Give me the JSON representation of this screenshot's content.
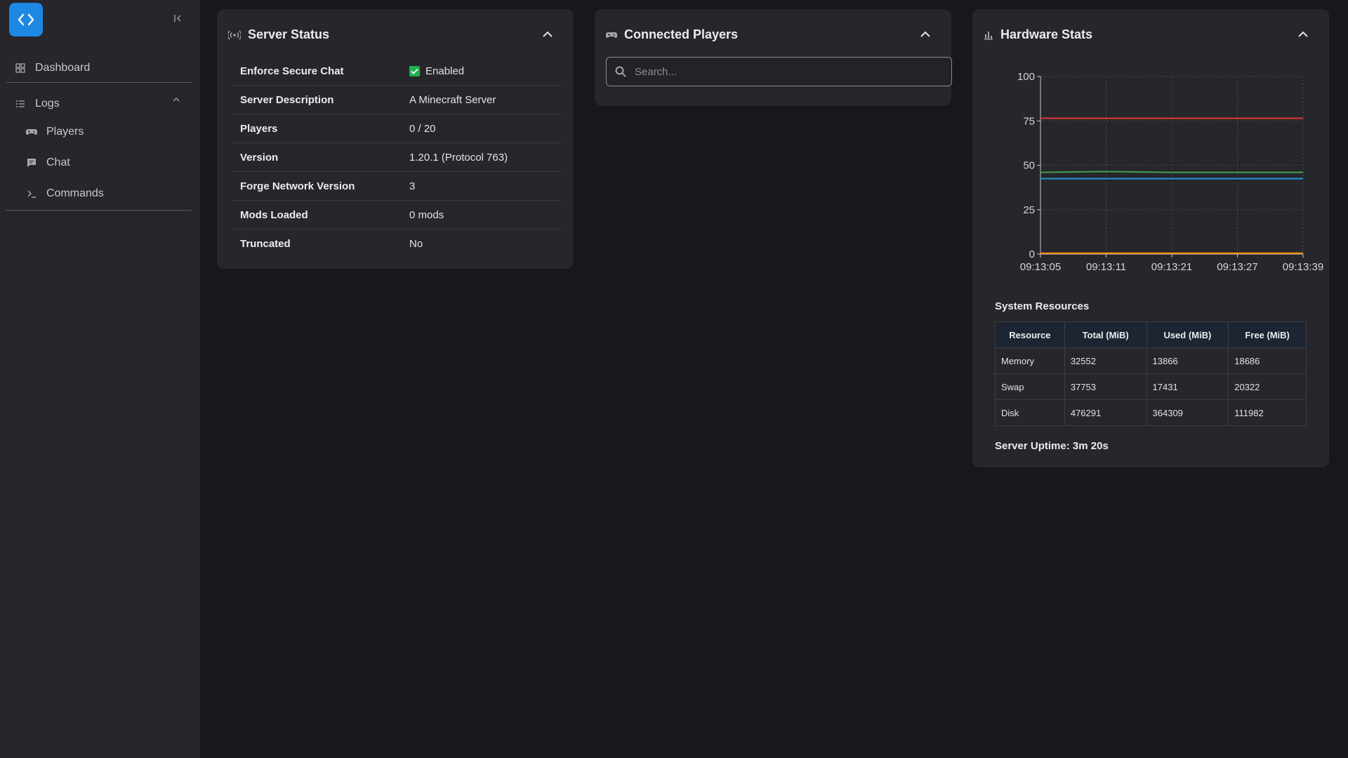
{
  "sidebar": {
    "items": [
      {
        "label": "Dashboard",
        "icon": "grid-icon"
      },
      {
        "label": "Logs",
        "icon": "list-icon"
      },
      {
        "label": "Players",
        "icon": "gamepad-icon"
      },
      {
        "label": "Chat",
        "icon": "chat-icon"
      },
      {
        "label": "Commands",
        "icon": "terminal-icon"
      }
    ]
  },
  "server_status": {
    "title": "Server Status",
    "rows": [
      {
        "key": "Enforce Secure Chat",
        "value": "Enabled"
      },
      {
        "key": "Server Description",
        "value": "A Minecraft Server"
      },
      {
        "key": "Players",
        "value": "0 / 20"
      },
      {
        "key": "Version",
        "value": "1.20.1 (Protocol 763)"
      },
      {
        "key": "Forge Network Version",
        "value": "3"
      },
      {
        "key": "Mods Loaded",
        "value": "0 mods"
      },
      {
        "key": "Truncated",
        "value": "No"
      }
    ]
  },
  "connected_players": {
    "title": "Connected Players",
    "search_placeholder": "Search..."
  },
  "hardware": {
    "title": "Hardware Stats",
    "resources_title": "System Resources",
    "table_headers": [
      "Resource",
      "Total (MiB)",
      "Used (MiB)",
      "Free (MiB)"
    ],
    "table_rows": [
      [
        "Memory",
        "32552",
        "13866",
        "18686"
      ],
      [
        "Swap",
        "37753",
        "17431",
        "20322"
      ],
      [
        "Disk",
        "476291",
        "364309",
        "111982"
      ]
    ],
    "uptime": "Server Uptime: 3m 20s"
  },
  "chart_data": {
    "type": "line",
    "x": [
      "09:13:05",
      "09:13:11",
      "09:13:21",
      "09:13:27",
      "09:13:39"
    ],
    "yticks": [
      0,
      25,
      50,
      75,
      100
    ],
    "ylim": [
      0,
      100
    ],
    "grid": true,
    "series": [
      {
        "color": "#e53935",
        "values": [
          76.5,
          76.5,
          76.5,
          76.5,
          76.5
        ]
      },
      {
        "color": "#43a047",
        "values": [
          46,
          46.5,
          46,
          46,
          46
        ]
      },
      {
        "color": "#1e9bd7",
        "values": [
          42.5,
          42.5,
          42.5,
          42.5,
          42.5
        ]
      },
      {
        "color": "#fb8c00",
        "values": [
          0.5,
          0.5,
          0.5,
          0.5,
          0.5
        ]
      }
    ]
  }
}
